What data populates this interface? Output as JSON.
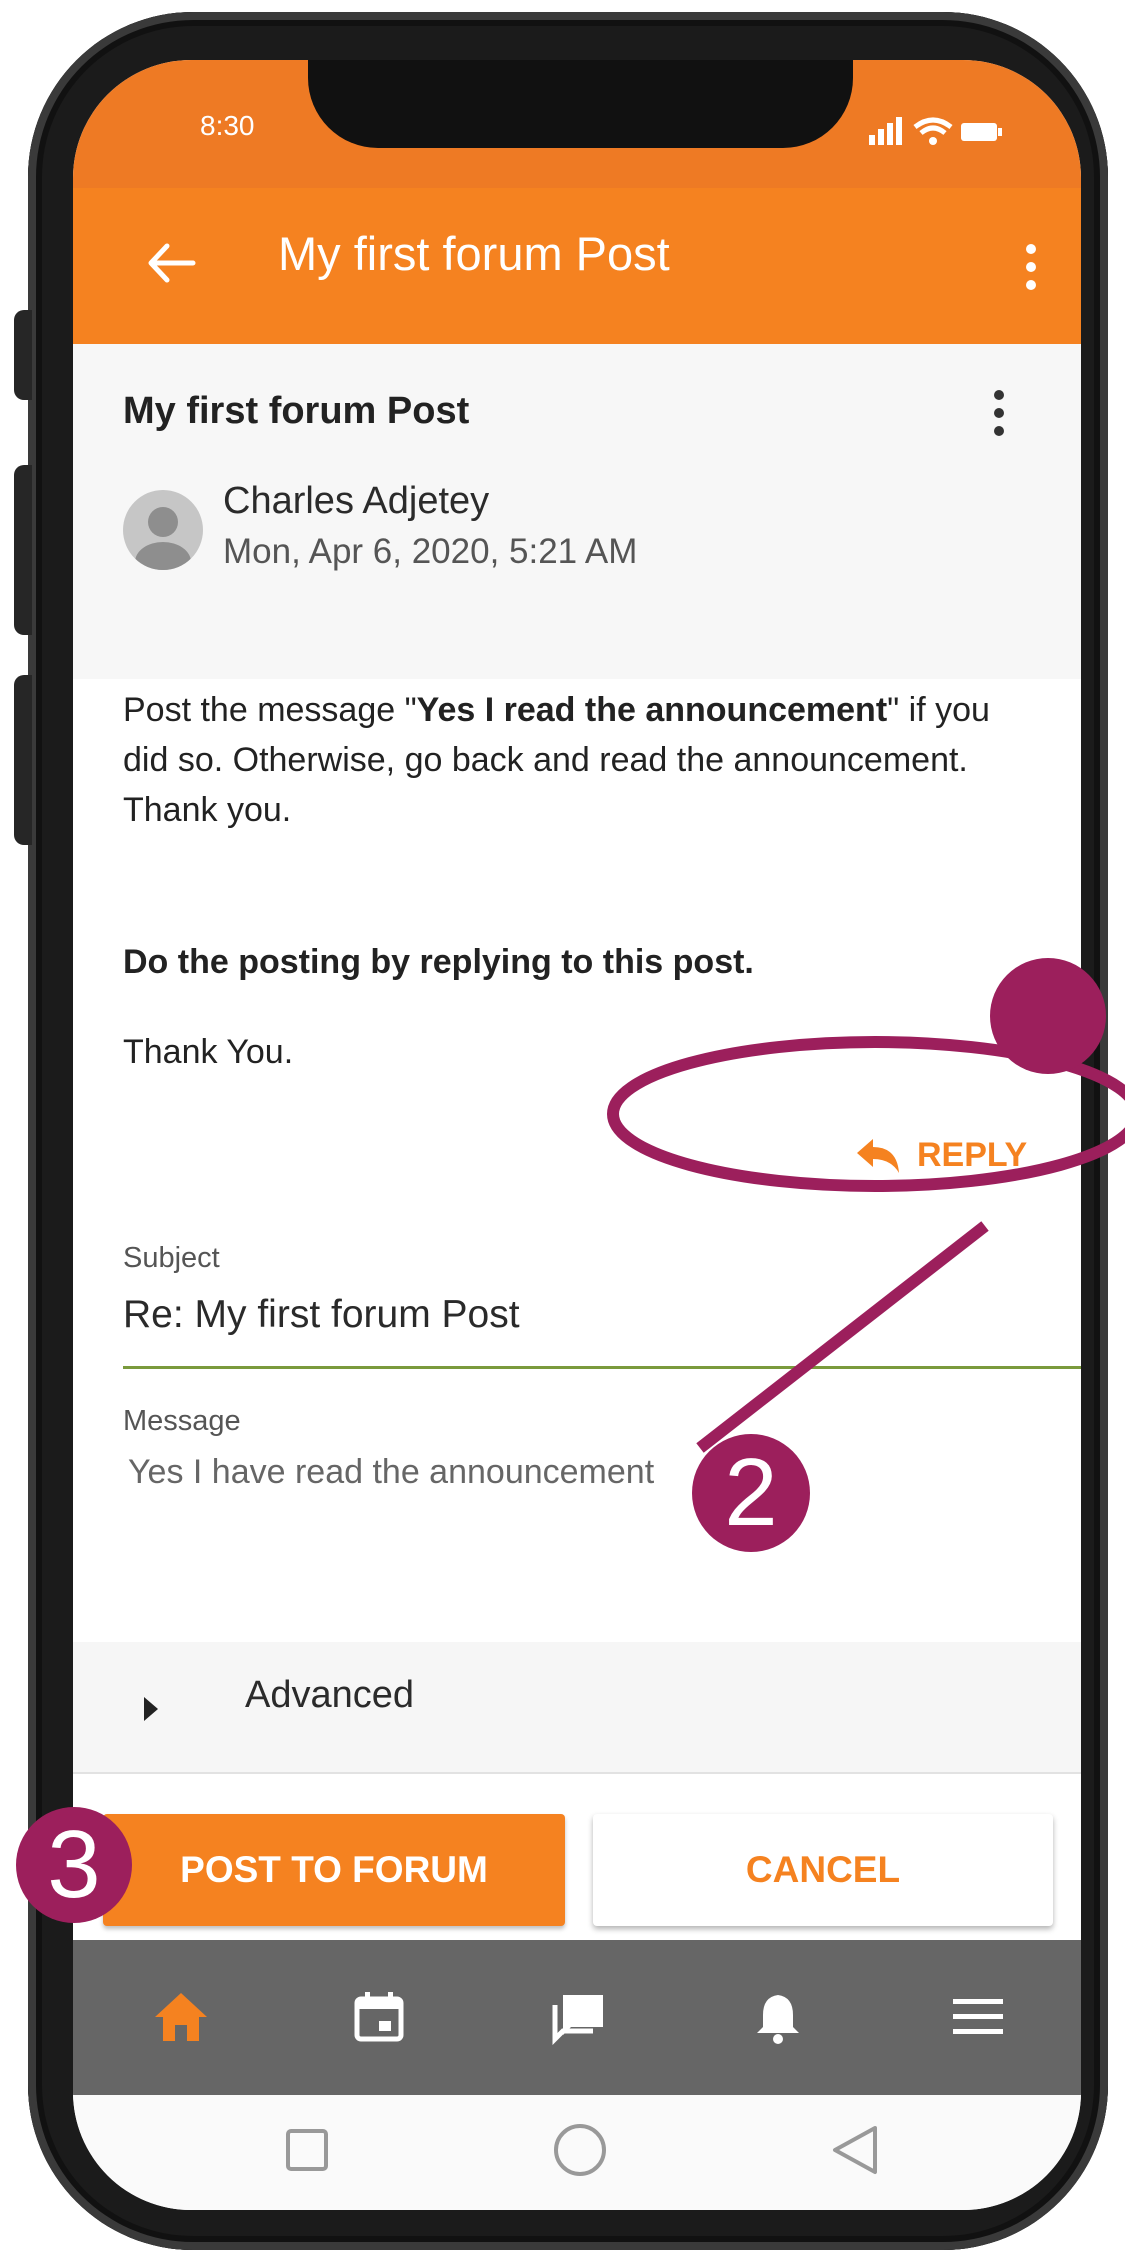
{
  "status_bar": {
    "time": "8:30"
  },
  "app_bar": {
    "title": "My first forum Post"
  },
  "post": {
    "title": "My first forum Post",
    "author": "Charles Adjetey",
    "date": "Mon, Apr 6, 2020, 5:21 AM",
    "paragraph1_pre": "Post the message \"",
    "paragraph1_bold": "Yes I read the announcement",
    "paragraph1_post": "\" if you did so. Otherwise, go back and read the announcement. Thank you.",
    "paragraph2": "Do the posting by replying to this post.",
    "paragraph3": "Thank You."
  },
  "reply_label": "REPLY",
  "form": {
    "subject_label": "Subject",
    "subject_value": "Re: My first forum Post",
    "message_label": "Message",
    "message_value": "Yes I have read the announcement",
    "advanced_label": "Advanced",
    "post_button": "POST TO FORUM",
    "cancel_button": "CANCEL"
  },
  "bottom_nav": [
    "home-icon",
    "calendar-icon",
    "forum-icon",
    "notifications-icon",
    "menu-icon"
  ],
  "annotations": {
    "step2": "2",
    "step3": "3"
  },
  "colors": {
    "accent": "#f58220",
    "annotation": "#9c1f5c",
    "nav_bg": "#666666"
  }
}
